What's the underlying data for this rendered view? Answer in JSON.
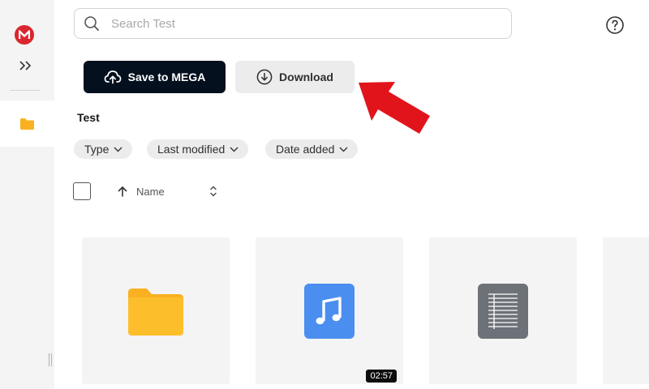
{
  "search": {
    "placeholder": "Search Test"
  },
  "actions": {
    "save_label": "Save to MEGA",
    "download_label": "Download"
  },
  "folder": {
    "title": "Test"
  },
  "filters": [
    {
      "label": "Type"
    },
    {
      "label": "Last modified"
    },
    {
      "label": "Date added"
    }
  ],
  "list_header": {
    "name_column": "Name"
  },
  "files": [
    {
      "kind": "folder"
    },
    {
      "kind": "audio",
      "duration": "02:57"
    },
    {
      "kind": "document"
    },
    {
      "kind": "unknown"
    }
  ],
  "colors": {
    "brand": "#d9272e",
    "save_button": "#04101e",
    "folder": "#f9b122",
    "audio": "#4a8ef0",
    "document": "#6d7178",
    "arrow": "#e2141b"
  }
}
